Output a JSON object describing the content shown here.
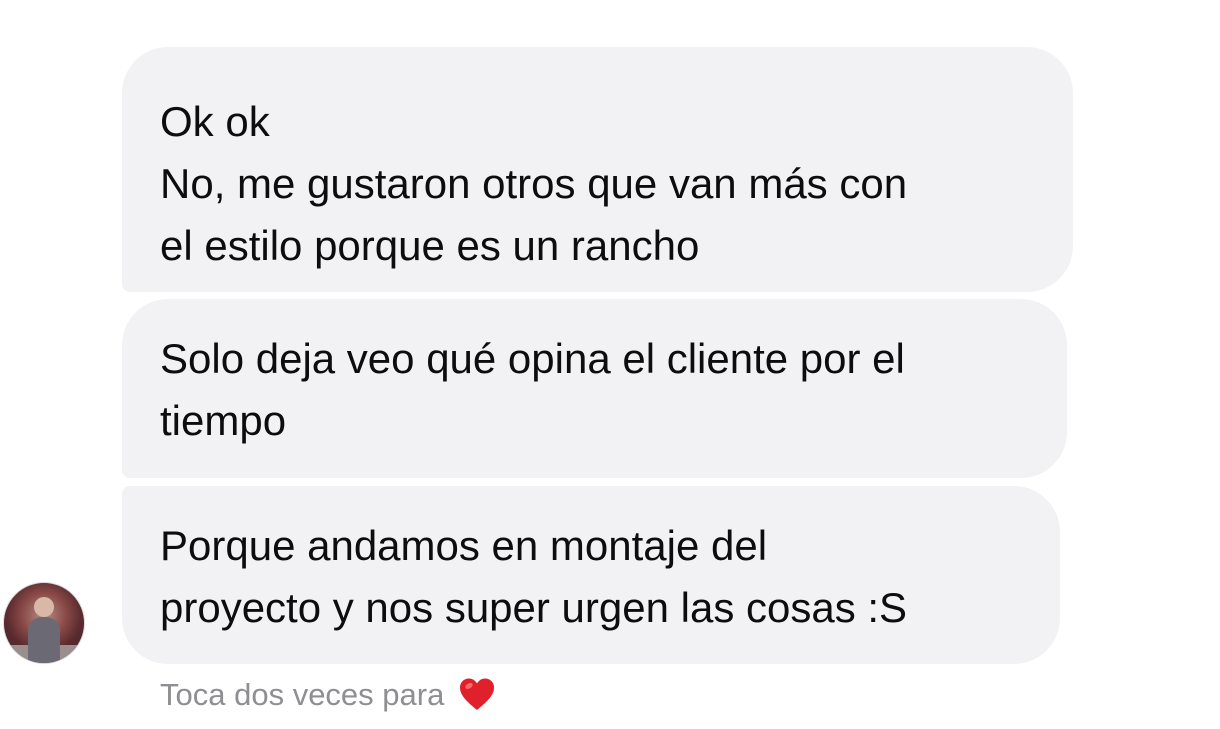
{
  "messages": [
    {
      "lines": [
        "Ok ok",
        "No, me gustaron otros que van más con",
        "el estilo porque es un rancho"
      ]
    },
    {
      "lines": [
        "Solo deja veo qué opina el cliente por el",
        "tiempo"
      ]
    },
    {
      "lines": [
        "Porque andamos en montaje del",
        "proyecto y nos super urgen las cosas :S"
      ]
    }
  ],
  "hint": {
    "text": "Toca dos veces para",
    "icon": "heart-icon",
    "icon_color": "#e0202b"
  },
  "colors": {
    "bubble_bg": "#f2f2f5",
    "text": "#0d0d0d",
    "hint_text": "#8e8e93"
  }
}
